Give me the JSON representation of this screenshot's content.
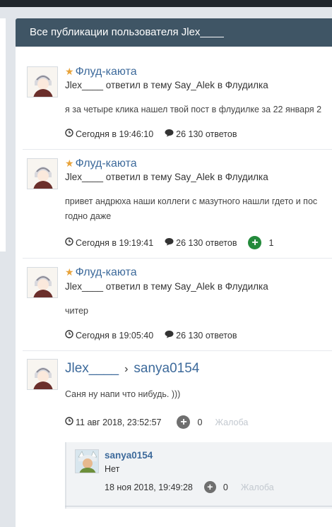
{
  "header": {
    "title": "Все публикации пользователя Jlex____"
  },
  "icons": {
    "star": "star-icon",
    "clock": "clock-icon",
    "comment": "comment-icon",
    "plus": "plus-circle-icon",
    "chevron": "chevron-right-icon"
  },
  "colors": {
    "header_bg": "#3f5565",
    "link": "#3d6a9b",
    "star": "#e8a33a",
    "plus_green": "#238a3b"
  },
  "posts": [
    {
      "forum": "Флуд-каюта",
      "action_prefix": "Jlex____ ответил в тему ",
      "topic": "Say_Alek",
      "action_mid": " в ",
      "section": "Флудилка",
      "excerpt_1": "я за четыре клика нашел твой пост в флудилке за 22 января 2",
      "time": "Сегодня в 19:46:10",
      "replies": "26 130 ответов"
    },
    {
      "forum": "Флуд-каюта",
      "action_prefix": "Jlex____ ответил в тему ",
      "topic": "Say_Alek",
      "action_mid": " в ",
      "section": "Флудилка",
      "excerpt_1": "привет андрюха наши коллеги с мазутного нашли гдето и пос",
      "excerpt_2": "годно даже",
      "time": "Сегодня в 19:19:41",
      "replies": "26 130 ответов",
      "reputation": "1"
    },
    {
      "forum": "Флуд-каюта",
      "action_prefix": "Jlex____ ответил в тему ",
      "topic": "Say_Alek",
      "action_mid": " в ",
      "section": "Флудилка",
      "excerpt_1": "читер",
      "time": "Сегодня в 19:05:40",
      "replies": "26 130 ответов"
    }
  ],
  "status": {
    "author": "Jlex____",
    "recipient": "sanya0154",
    "text": "Саня ну напи что нибудь. )))",
    "time": "11 авг 2018, 23:52:57",
    "reputation": "0",
    "complaint": "Жалоба",
    "reply": {
      "author": "sanya0154",
      "text": "Нет",
      "time": "18 ноя 2018, 19:49:28",
      "reputation": "0",
      "complaint": "Жалоба"
    }
  }
}
